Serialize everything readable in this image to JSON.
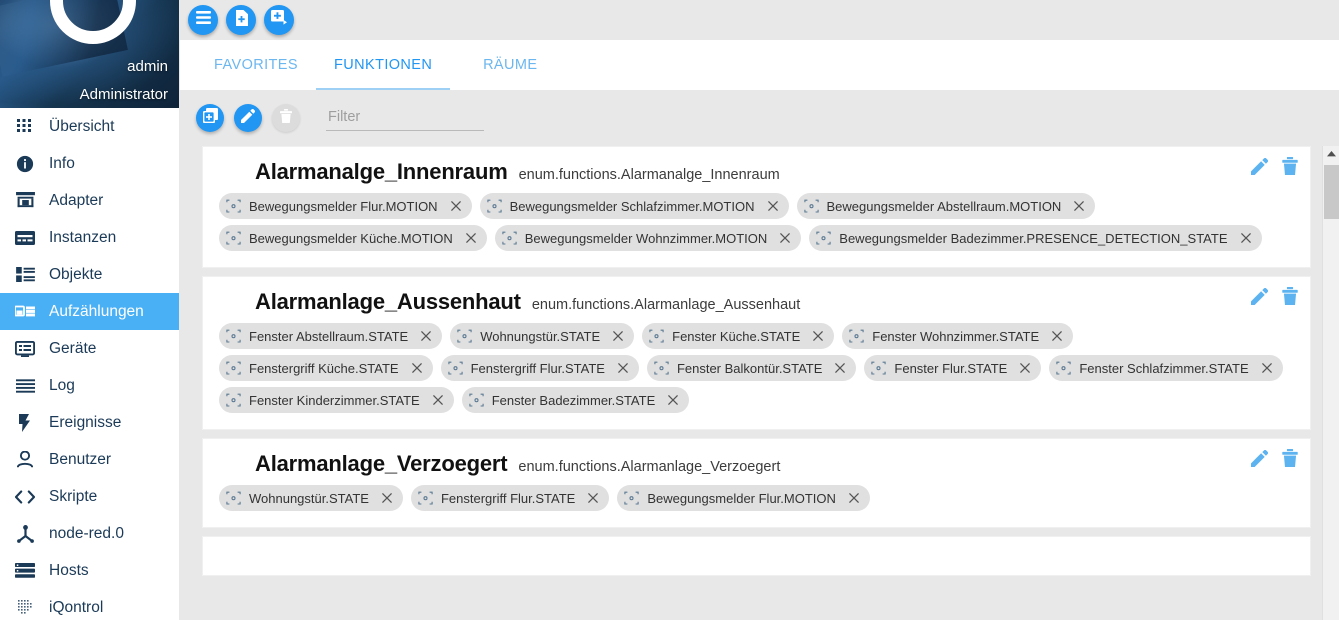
{
  "sidebar": {
    "profile": {
      "username": "admin",
      "role": "Administrator"
    },
    "items": [
      {
        "label": "Übersicht",
        "icon": "grid-icon",
        "active": false
      },
      {
        "label": "Info",
        "icon": "info-icon",
        "active": false
      },
      {
        "label": "Adapter",
        "icon": "store-icon",
        "active": false
      },
      {
        "label": "Instanzen",
        "icon": "instances-icon",
        "active": false
      },
      {
        "label": "Objekte",
        "icon": "list-objects-icon",
        "active": false
      },
      {
        "label": "Aufzählungen",
        "icon": "enums-icon",
        "active": true
      },
      {
        "label": "Geräte",
        "icon": "devices-icon",
        "active": false
      },
      {
        "label": "Log",
        "icon": "log-lines-icon",
        "active": false
      },
      {
        "label": "Ereignisse",
        "icon": "bolt-icon",
        "active": false
      },
      {
        "label": "Benutzer",
        "icon": "user-icon",
        "active": false
      },
      {
        "label": "Skripte",
        "icon": "code-brackets-icon",
        "active": false
      },
      {
        "label": "node-red.0",
        "icon": "node-red-icon",
        "active": false
      },
      {
        "label": "Hosts",
        "icon": "server-icon",
        "active": false
      },
      {
        "label": "iQontrol",
        "icon": "dots-matrix-icon",
        "active": false
      }
    ]
  },
  "toolbar": {
    "buttons": [
      {
        "icon": "list-view-icon",
        "name": "list-view-button"
      },
      {
        "icon": "file-icon",
        "name": "new-file-button"
      },
      {
        "icon": "add-copy-icon",
        "name": "add-copy-button"
      }
    ]
  },
  "tabs": [
    {
      "label": "FAVORITES",
      "active": false
    },
    {
      "label": "FUNKTIONEN",
      "active": true
    },
    {
      "label": "RÄUME",
      "active": false
    }
  ],
  "filterbar": {
    "add_label": "add-enum-button",
    "edit_label": "edit-button",
    "delete_label": "delete-button",
    "filter_placeholder": "Filter",
    "filter_value": ""
  },
  "colors": {
    "accent": "#2196f3",
    "accent_light": "#5cb3f0",
    "sidebar_active": "#4ab0f5",
    "chip_bg": "#e0e0e0",
    "page_bg": "#e8e8e8"
  },
  "cards": [
    {
      "title": "Alarmanalge_Innenraum",
      "subtitle": "enum.functions.Alarmanalge_Innenraum",
      "chips": [
        "Bewegungsmelder Flur.MOTION",
        "Bewegungsmelder Schlafzimmer.MOTION",
        "Bewegungsmelder Abstellraum.MOTION",
        "Bewegungsmelder Küche.MOTION",
        "Bewegungsmelder Wohnzimmer.MOTION",
        "Bewegungsmelder Badezimmer.PRESENCE_DETECTION_STATE"
      ]
    },
    {
      "title": "Alarmanlage_Aussenhaut",
      "subtitle": "enum.functions.Alarmanlage_Aussenhaut",
      "chips": [
        "Fenster Abstellraum.STATE",
        "Wohnungstür.STATE",
        "Fenster Küche.STATE",
        "Fenster Wohnzimmer.STATE",
        "Fenstergriff Küche.STATE",
        "Fenstergriff Flur.STATE",
        "Fenster Balkontür.STATE",
        "Fenster Flur.STATE",
        "Fenster Schlafzimmer.STATE",
        "Fenster Kinderzimmer.STATE",
        "Fenster Badezimmer.STATE"
      ]
    },
    {
      "title": "Alarmanlage_Verzoegert",
      "subtitle": "enum.functions.Alarmanlage_Verzoegert",
      "chips": [
        "Wohnungstür.STATE",
        "Fenstergriff Flur.STATE",
        "Bewegungsmelder Flur.MOTION"
      ]
    }
  ],
  "card_actions": {
    "edit": "edit-icon",
    "delete": "delete-icon"
  }
}
